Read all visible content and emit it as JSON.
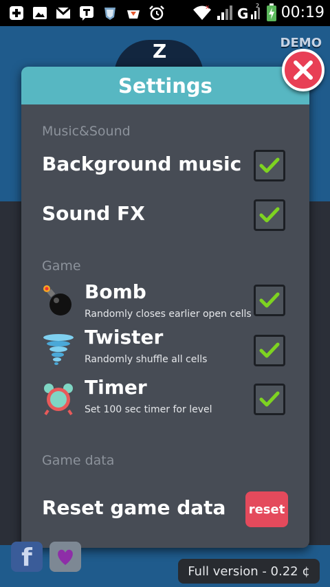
{
  "status_bar": {
    "time": "00:19",
    "icons": [
      "notification-plus-icon",
      "gallery-icon",
      "gmail-icon",
      "talk-icon",
      "shield-icon",
      "game-icon",
      "alarm-icon",
      "wifi-icon",
      "signal-icon",
      "signal-g-icon",
      "battery-icon"
    ]
  },
  "background": {
    "demo_label": "DEMO",
    "mascot_letter": "Z"
  },
  "dialog": {
    "title": "Settings",
    "sections": {
      "music_sound": "Music&Sound",
      "game": "Game",
      "game_data": "Game data"
    },
    "background_music": {
      "label": "Background music",
      "checked": true
    },
    "sound_fx": {
      "label": "Sound FX",
      "checked": true
    },
    "bomb": {
      "title": "Bomb",
      "desc": "Randomly closes earlier open cells",
      "checked": true
    },
    "twister": {
      "title": "Twister",
      "desc": "Randomly shuffle all cells",
      "checked": true
    },
    "timer": {
      "title": "Timer",
      "desc": "Set 100 sec timer for level",
      "checked": true
    },
    "reset": {
      "label": "Reset game data",
      "button": "reset"
    }
  },
  "footer": {
    "facebook_glyph": "f",
    "full_version": "Full version - 0.22 ¢"
  },
  "colors": {
    "header": "#57b7c2",
    "dialog": "#474c55",
    "close": "#e83f55",
    "reset": "#e44a5c",
    "check": "#7ed321",
    "game_bg": "#1f5b8c"
  }
}
